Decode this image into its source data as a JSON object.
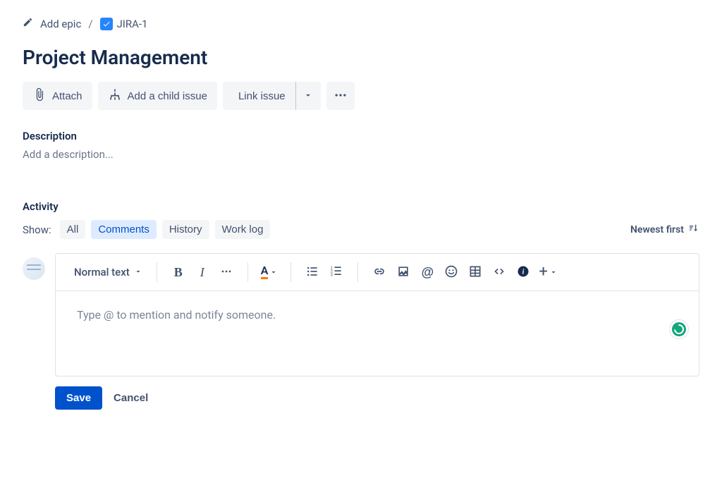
{
  "breadcrumb": {
    "add_epic": "Add epic",
    "issue_key": "JIRA-1"
  },
  "title": "Project Management",
  "toolbar": {
    "attach": "Attach",
    "add_child": "Add a child issue",
    "link_issue": "Link issue"
  },
  "description": {
    "label": "Description",
    "placeholder": "Add a description..."
  },
  "activity": {
    "label": "Activity",
    "show_label": "Show:",
    "tabs": {
      "all": "All",
      "comments": "Comments",
      "history": "History",
      "worklog": "Work log"
    },
    "active_tab": "comments",
    "sort": "Newest first"
  },
  "editor": {
    "text_style": "Normal text",
    "placeholder": "Type @ to mention and notify someone.",
    "text_color_letter": "A"
  },
  "actions": {
    "save": "Save",
    "cancel": "Cancel"
  }
}
